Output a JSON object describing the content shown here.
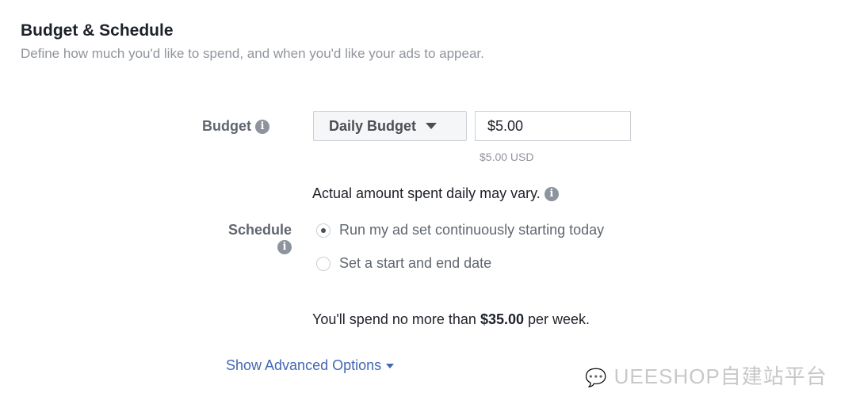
{
  "header": {
    "title": "Budget & Schedule",
    "subtitle": "Define how much you'd like to spend, and when you'd like your ads to appear."
  },
  "budget": {
    "label": "Budget",
    "type_selected": "Daily Budget",
    "amount": "$5.00",
    "amount_converted": "$5.00 USD",
    "note": "Actual amount spent daily may vary."
  },
  "schedule": {
    "label": "Schedule",
    "options": [
      {
        "label": "Run my ad set continuously starting today",
        "selected": true
      },
      {
        "label": "Set a start and end date",
        "selected": false
      }
    ]
  },
  "summary": {
    "prefix": "You'll spend no more than",
    "amount": "$35.00",
    "suffix": "per week."
  },
  "advanced": {
    "label": "Show Advanced Options"
  },
  "watermark": {
    "text": "UEESHOP自建站平台"
  },
  "icons": {
    "info": "i"
  }
}
